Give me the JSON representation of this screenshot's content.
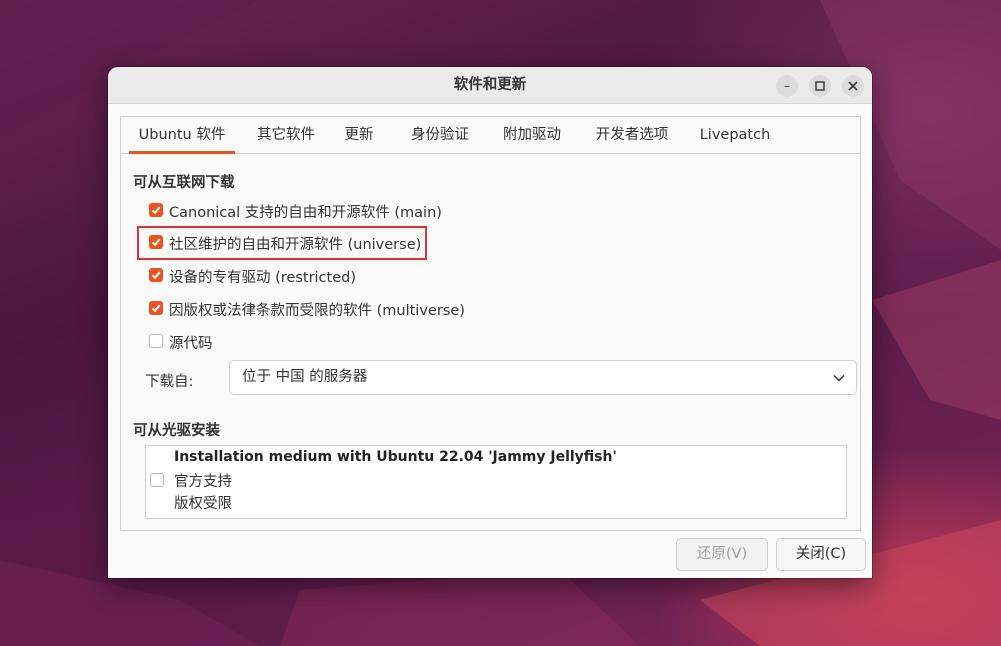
{
  "window": {
    "title": "软件和更新"
  },
  "tabs": [
    "Ubuntu 软件",
    "其它软件",
    "更新",
    "身份验证",
    "附加驱动",
    "开发者选项",
    "Livepatch"
  ],
  "internet": {
    "heading": "可从互联网下载",
    "items": [
      {
        "label": "Canonical 支持的自由和开源软件 (main)",
        "checked": true
      },
      {
        "label": "社区维护的自由和开源软件 (universe)",
        "checked": true
      },
      {
        "label": "设备的专有驱动 (restricted)",
        "checked": true
      },
      {
        "label": "因版权或法律条款而受限的软件 (multiverse)",
        "checked": true
      },
      {
        "label": "源代码",
        "checked": false
      }
    ],
    "download_label": "下载自:",
    "download_value": "位于 中国 的服务器"
  },
  "cdrom": {
    "heading": "可从光驱安装",
    "medium_title": "Installation medium with Ubuntu 22.04 'Jammy Jellyfish'",
    "line1": "官方支持",
    "line2": "版权受限",
    "checked": false
  },
  "buttons": {
    "revert": "还原(V)",
    "close": "关闭(C)"
  },
  "colors": {
    "accent": "#e95420",
    "highlight": "#e0322f"
  }
}
